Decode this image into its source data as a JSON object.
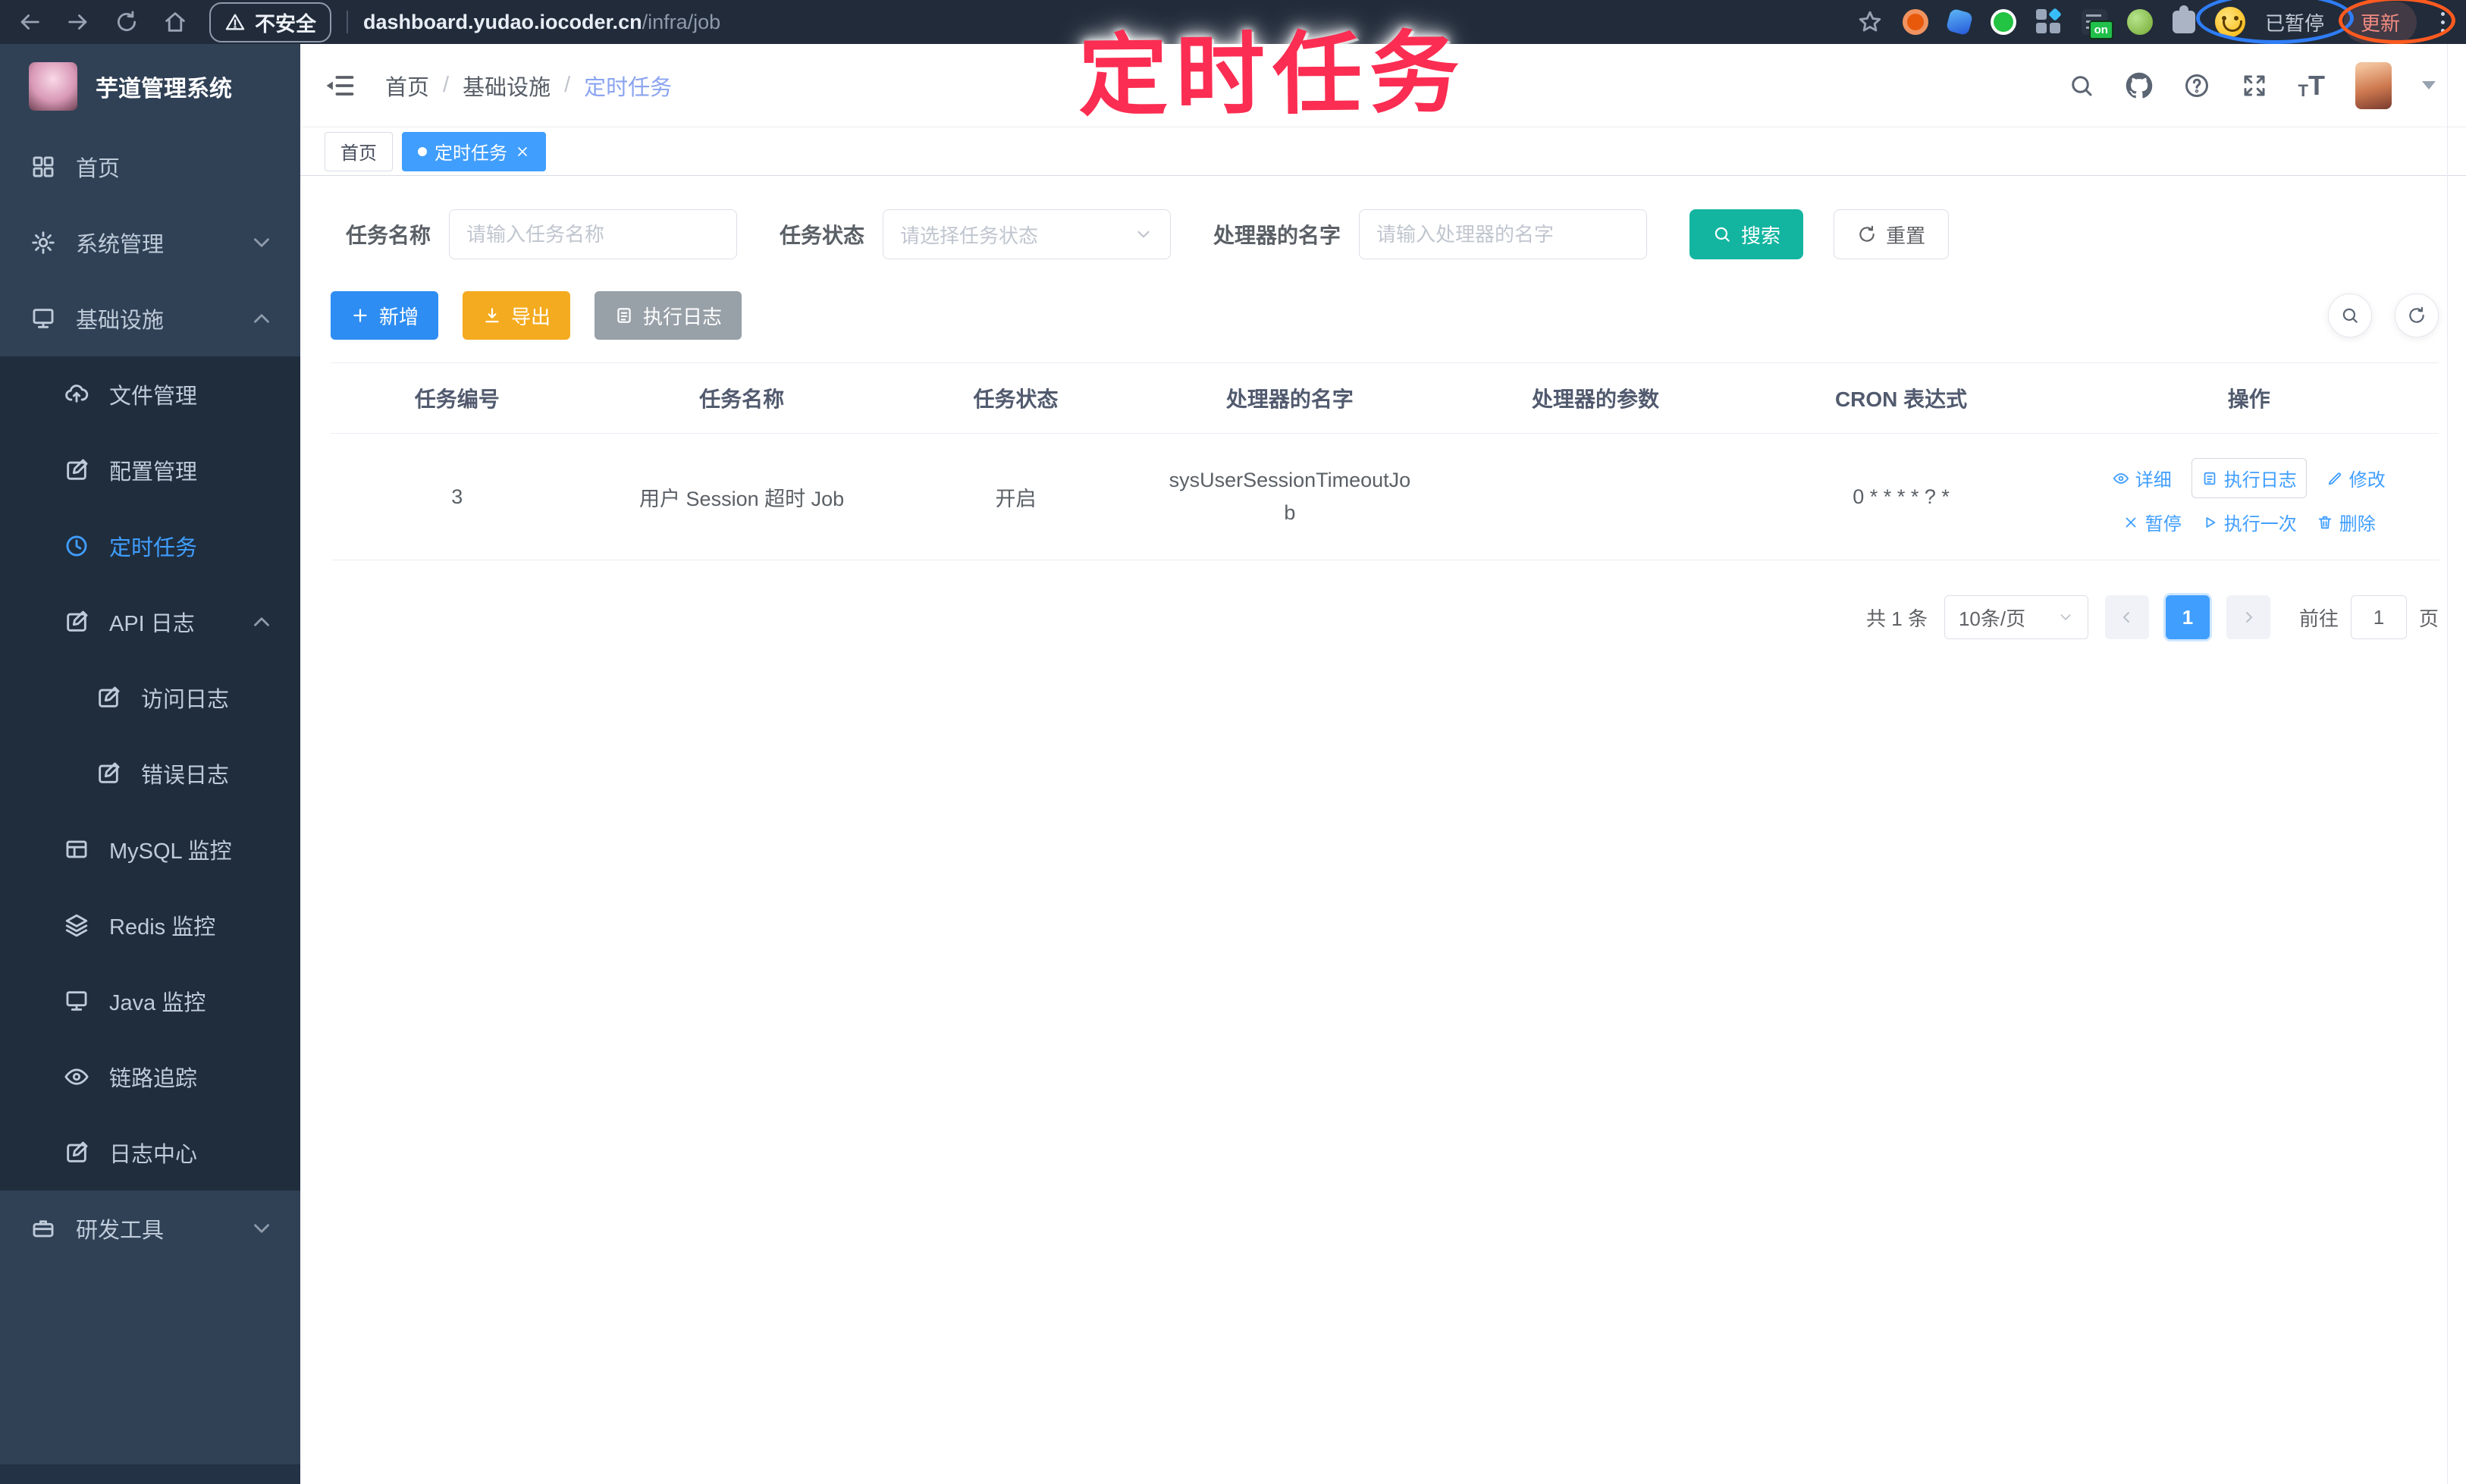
{
  "browser": {
    "security_label": "不安全",
    "url_host": "dashboard.yudao.iocoder.cn",
    "url_path": "/infra/job",
    "ext_on_badge": "on",
    "paused_label": "已暂停",
    "update_label": "更新"
  },
  "annotation": {
    "title": "定时任务"
  },
  "sidebar": {
    "logo_title": "芋道管理系统",
    "items": [
      {
        "label": "首页"
      },
      {
        "label": "系统管理"
      },
      {
        "label": "基础设施"
      },
      {
        "label": "文件管理"
      },
      {
        "label": "配置管理"
      },
      {
        "label": "定时任务"
      },
      {
        "label": "API 日志"
      },
      {
        "label": "访问日志"
      },
      {
        "label": "错误日志"
      },
      {
        "label": "MySQL 监控"
      },
      {
        "label": "Redis 监控"
      },
      {
        "label": "Java 监控"
      },
      {
        "label": "链路追踪"
      },
      {
        "label": "日志中心"
      },
      {
        "label": "研发工具"
      }
    ]
  },
  "navbar": {
    "breadcrumb": [
      "首页",
      "基础设施",
      "定时任务"
    ]
  },
  "tags": [
    {
      "label": "首页"
    },
    {
      "label": "定时任务"
    }
  ],
  "filters": {
    "task_name_label": "任务名称",
    "task_name_placeholder": "请输入任务名称",
    "task_status_label": "任务状态",
    "task_status_placeholder": "请选择任务状态",
    "handler_label": "处理器的名字",
    "handler_placeholder": "请输入处理器的名字",
    "search_label": "搜索",
    "reset_label": "重置"
  },
  "toolbar": {
    "add_label": "新增",
    "export_label": "导出",
    "exec_log_label": "执行日志"
  },
  "table": {
    "headers": [
      "任务编号",
      "任务名称",
      "任务状态",
      "处理器的名字",
      "处理器的参数",
      "CRON 表达式",
      "操作"
    ],
    "rows": [
      {
        "id": "3",
        "name": "用户 Session 超时 Job",
        "status": "开启",
        "handler": "sysUserSessionTimeoutJob",
        "param": "",
        "cron": "0 * * * * ? *"
      }
    ],
    "row_actions": [
      "详细",
      "执行日志",
      "修改",
      "暂停",
      "执行一次",
      "删除"
    ]
  },
  "pagination": {
    "total": "共 1 条",
    "page_size": "10条/页",
    "current_page": "1",
    "goto_label": "前往",
    "goto_value": "1",
    "goto_unit": "页"
  },
  "colors": {
    "primary": "#409eff",
    "sidebar_bg": "#304156",
    "submenu_bg": "#1f2d3d",
    "search_button": "#13b5a0",
    "add_button": "#2e8df2",
    "export_button": "#f5ab1f",
    "info_button": "#98a0a8",
    "active_tag": "#409eff",
    "annotation": "#fb2d52"
  }
}
